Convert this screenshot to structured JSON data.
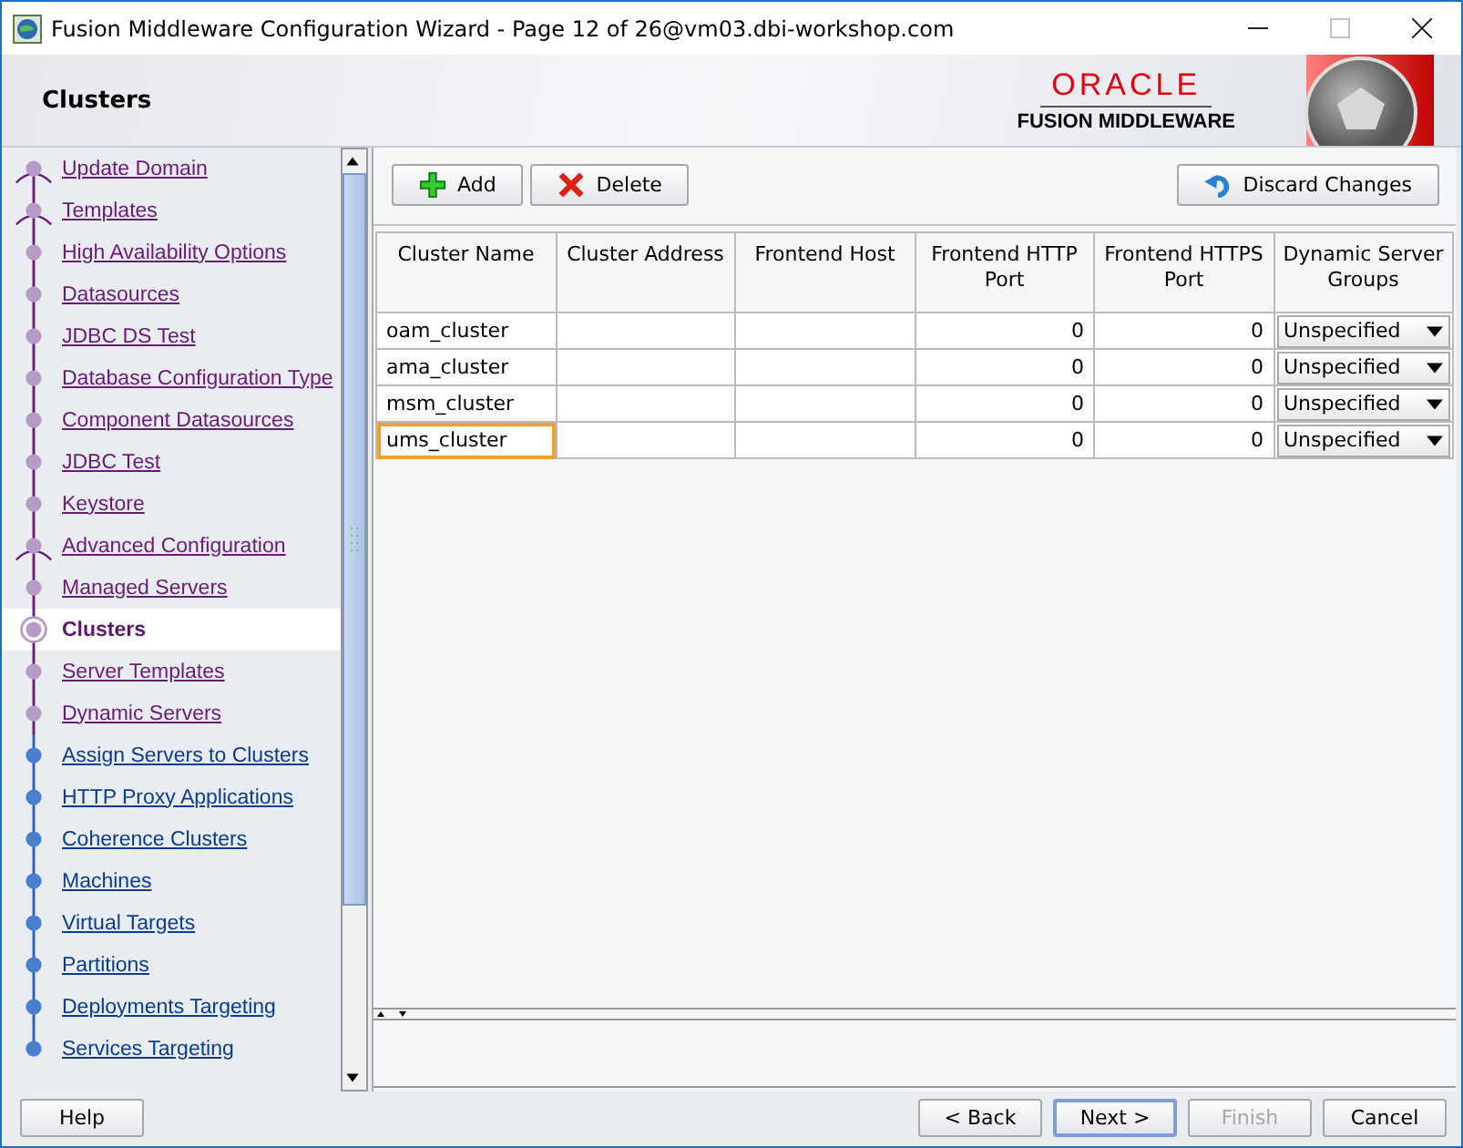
{
  "window": {
    "title": "Fusion Middleware Configuration Wizard - Page 12 of 26@vm03.dbi-workshop.com"
  },
  "header": {
    "title": "Clusters",
    "logo_brand": "ORACLE",
    "logo_product": "FUSION MIDDLEWARE"
  },
  "steps": [
    {
      "label": "Update Domain",
      "visited": true,
      "branch": true,
      "selected": false
    },
    {
      "label": "Templates",
      "visited": true,
      "branch": true,
      "selected": false
    },
    {
      "label": "High Availability Options",
      "visited": true,
      "branch": false,
      "selected": false
    },
    {
      "label": "Datasources",
      "visited": true,
      "branch": false,
      "selected": false
    },
    {
      "label": "JDBC DS Test",
      "visited": true,
      "branch": false,
      "selected": false
    },
    {
      "label": "Database Configuration Type",
      "visited": true,
      "branch": false,
      "selected": false
    },
    {
      "label": "Component Datasources",
      "visited": true,
      "branch": false,
      "selected": false
    },
    {
      "label": "JDBC Test",
      "visited": true,
      "branch": false,
      "selected": false
    },
    {
      "label": "Keystore",
      "visited": true,
      "branch": false,
      "selected": false
    },
    {
      "label": "Advanced Configuration",
      "visited": true,
      "branch": true,
      "selected": false
    },
    {
      "label": "Managed Servers",
      "visited": true,
      "branch": false,
      "selected": false
    },
    {
      "label": "Clusters",
      "visited": true,
      "branch": false,
      "selected": true
    },
    {
      "label": "Server Templates",
      "visited": true,
      "branch": false,
      "selected": false
    },
    {
      "label": "Dynamic Servers",
      "visited": true,
      "branch": false,
      "selected": false
    },
    {
      "label": "Assign Servers to Clusters",
      "visited": false,
      "branch": false,
      "selected": false
    },
    {
      "label": "HTTP Proxy Applications",
      "visited": false,
      "branch": false,
      "selected": false
    },
    {
      "label": "Coherence Clusters",
      "visited": false,
      "branch": false,
      "selected": false
    },
    {
      "label": "Machines",
      "visited": false,
      "branch": false,
      "selected": false
    },
    {
      "label": "Virtual Targets",
      "visited": false,
      "branch": false,
      "selected": false
    },
    {
      "label": "Partitions",
      "visited": false,
      "branch": false,
      "selected": false
    },
    {
      "label": "Deployments Targeting",
      "visited": false,
      "branch": false,
      "selected": false
    },
    {
      "label": "Services Targeting",
      "visited": false,
      "branch": false,
      "selected": false
    }
  ],
  "toolbar": {
    "add": "Add",
    "delete": "Delete",
    "discard": "Discard Changes"
  },
  "table": {
    "columns": [
      "Cluster Name",
      "Cluster Address",
      "Frontend Host",
      "Frontend HTTP Port",
      "Frontend HTTPS Port",
      "Dynamic Server Groups"
    ],
    "rows": [
      {
        "name": "oam_cluster",
        "http_port": "0",
        "https_port": "0",
        "server_groups": "Unspecified",
        "focused": false
      },
      {
        "name": "ama_cluster",
        "http_port": "0",
        "https_port": "0",
        "server_groups": "Unspecified",
        "focused": false
      },
      {
        "name": "msm_cluster",
        "http_port": "0",
        "https_port": "0",
        "server_groups": "Unspecified",
        "focused": false
      },
      {
        "name": "ums_cluster",
        "http_port": "0",
        "https_port": "0",
        "server_groups": "Unspecified",
        "focused": true
      }
    ]
  },
  "buttons": [
    {
      "label": "Help",
      "kind": "help",
      "disabled": false,
      "default": false
    },
    {
      "label": "< Back",
      "kind": "nav",
      "disabled": false,
      "default": false
    },
    {
      "label": "Next >",
      "kind": "nav",
      "disabled": false,
      "default": true
    },
    {
      "label": "Finish",
      "kind": "nav",
      "disabled": true,
      "default": false
    },
    {
      "label": "Cancel",
      "kind": "nav",
      "disabled": false,
      "default": false
    }
  ]
}
